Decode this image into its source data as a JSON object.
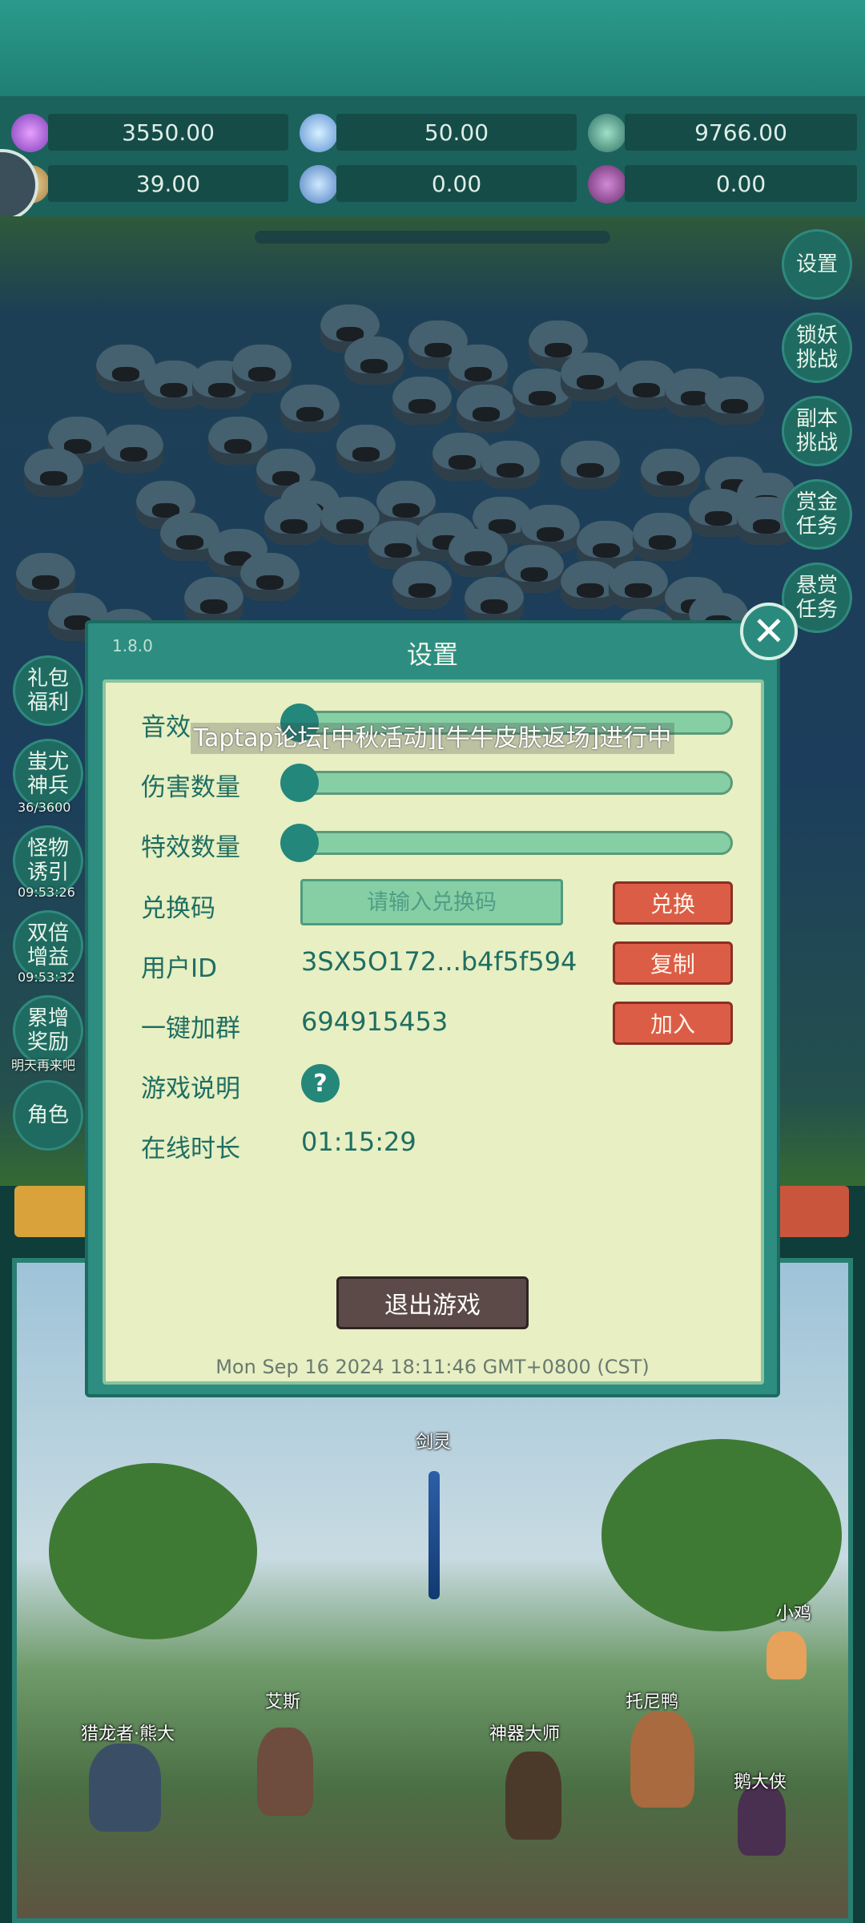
{
  "resources": {
    "row1": [
      "3550.00",
      "50.00",
      "9766.00"
    ],
    "row2": [
      "39.00",
      "0.00",
      "0.00"
    ]
  },
  "marquee": "Taptap论坛[中秋活动][牛牛皮肤返场]进行中",
  "right_menu": [
    {
      "label": "设置"
    },
    {
      "label": "锁妖挑战"
    },
    {
      "label": "副本挑战"
    },
    {
      "label": "赏金任务"
    },
    {
      "label": "悬赏任务"
    }
  ],
  "left_menu": [
    {
      "label": "礼包福利",
      "sub": ""
    },
    {
      "label": "蚩尤神兵",
      "sub": "36/3600"
    },
    {
      "label": "怪物诱引",
      "sub": "09:53:26"
    },
    {
      "label": "双倍增益",
      "sub": "09:53:32"
    },
    {
      "label": "累增奖励",
      "sub": "明天再来吧"
    },
    {
      "label": "角色",
      "sub": ""
    }
  ],
  "dialog": {
    "version": "1.8.0",
    "title": "设置",
    "sound_label": "音效",
    "sound_level": 0.0,
    "damage_label": "伤害数量",
    "damage_level": 0.0,
    "effect_label": "特效数量",
    "effect_level": 0.0,
    "redeem_label": "兑换码",
    "redeem_placeholder": "请输入兑换码",
    "redeem_button": "兑换",
    "user_label": "用户ID",
    "user_value": "3SX5O172...b4f5f594",
    "copy_button": "复制",
    "group_label": "一键加群",
    "group_value": "694915453",
    "join_button": "加入",
    "guide_label": "游戏说明",
    "guide_icon": "?",
    "online_label": "在线时长",
    "online_value": "01:15:29",
    "exit_button": "退出游戏",
    "timestamp": "Mon Sep 16 2024 18:11:46 GMT+0800 (CST)"
  },
  "scene": {
    "names": [
      "剑灵",
      "小鸡",
      "艾斯",
      "托尼鸭",
      "神器大师",
      "猎龙者·熊大",
      "鹅大侠"
    ]
  },
  "colors": {
    "accent": "#2d8d80",
    "panel": "#e7efc3",
    "red_button": "#dc5d46",
    "exit_button": "#5b4a47"
  }
}
